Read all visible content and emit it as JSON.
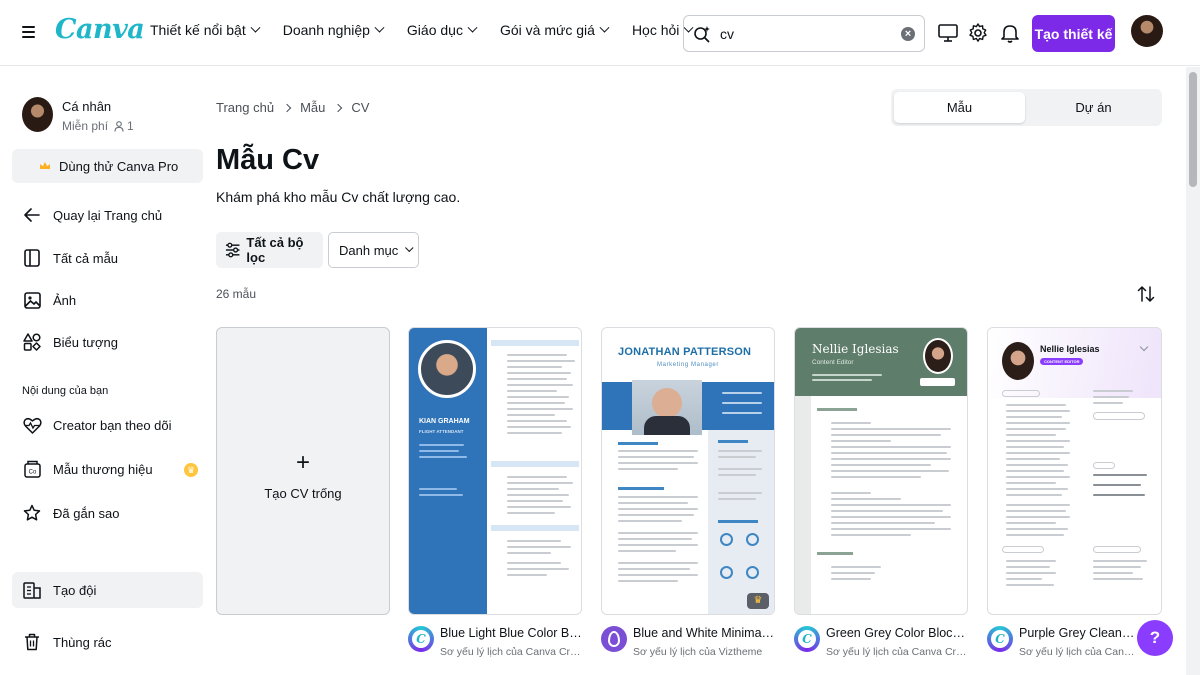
{
  "topbar": {
    "logo": "Canva",
    "nav": [
      "Thiết kế nổi bật",
      "Doanh nghiệp",
      "Giáo dục",
      "Gói và mức giá",
      "Học hỏi"
    ],
    "search_value": "cv",
    "cta_label": "Tạo thiết kế"
  },
  "sidebar": {
    "profile_name": "Cá nhân",
    "profile_plan": "Miễn phí",
    "profile_members": "1",
    "try_pro": "Dùng thử Canva Pro",
    "items_top": [
      "Quay lại Trang chủ",
      "Tất cả mẫu",
      "Ảnh",
      "Biểu tượng"
    ],
    "section_label": "Nội dung của bạn",
    "items_content": [
      "Creator bạn theo dõi",
      "Mẫu thương hiệu",
      "Đã gắn sao"
    ],
    "team": "Tạo đội",
    "trash": "Thùng rác"
  },
  "main": {
    "breadcrumb": [
      "Trang chủ",
      "Mẫu",
      "CV"
    ],
    "tabs": [
      "Mẫu",
      "Dự án"
    ],
    "title": "Mẫu Cv",
    "description": "Khám phá kho mẫu Cv chất lượng cao.",
    "filter_label": "Tất cả bộ lọc",
    "category_label": "Danh mục",
    "count": "26 mẫu",
    "blank_card_label": "Tạo CV trống",
    "cards": [
      {
        "title": "Blue Light Blue Color Blo...",
        "subtitle": "Sơ yếu lý lịch của Canva Creati...",
        "thumb_name": "KIAN GRAHAM",
        "thumb_role": "FLIGHT ATTENDANT"
      },
      {
        "title": "Blue and White Minimali...",
        "subtitle": "Sơ yếu lý lịch của Viztheme",
        "thumb_name": "JONATHAN PATTERSON",
        "thumb_role": "Marketing Manager"
      },
      {
        "title": "Green Grey Color Blocks ...",
        "subtitle": "Sơ yếu lý lịch của Canva Creati...",
        "thumb_name": "Nellie Iglesias",
        "thumb_role": "Content Editor"
      },
      {
        "title": "Purple Grey Clean UI C...",
        "subtitle": "Sơ yếu lý lịch của Canva Creati...",
        "thumb_name": "Nellie Iglesias",
        "thumb_role": "CONTENT EDITOR"
      }
    ],
    "help": "?"
  },
  "colors": {
    "brand_teal": "#1fb6c9",
    "cta_purple": "#7d2ae8",
    "help_purple": "#8b3dff",
    "cv_blue": "#2f73b8",
    "cv_green": "#5f7d6b"
  }
}
